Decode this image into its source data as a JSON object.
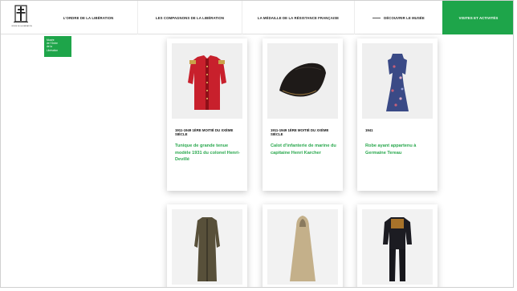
{
  "header": {
    "logo_text": "ORDRE DE LA LIBÉRATION",
    "nav": [
      {
        "label": "L'ORDRE DE LA LIBÉRATION"
      },
      {
        "label": "LES COMPAGNONS DE LA LIBÉRATION"
      },
      {
        "label": "LA MÉDAILLE DE LA RÉSISTANCE FRANÇAISE"
      },
      {
        "label": "DÉCOUVRIR LE MUSÉE"
      },
      {
        "label": "VISITES ET ACTIVITÉS"
      }
    ]
  },
  "badge": {
    "lines": [
      "Musée",
      "de l'Ordre",
      "de la",
      "Libération"
    ]
  },
  "cards": [
    {
      "date": "1911-1949 1ÈRE MOITIÉ DU XXÈME SIÈCLE",
      "title": "Tunique de grande tenue modèle 1931 du colonel Henri-Devillé",
      "image": "red-tunic"
    },
    {
      "date": "1911-1949 1ÈRE MOITIÉ DU XXÈME SIÈCLE",
      "title": "Calot d'infanterie de marine du capitaine Henri Karcher",
      "image": "calot-cap"
    },
    {
      "date": "1941",
      "title": "Robe ayant appartenu à Germaine Tereau",
      "image": "floral-dress"
    },
    {
      "date": "",
      "title": "",
      "image": "military-coat"
    },
    {
      "date": "",
      "title": "",
      "image": "hooded-cape"
    },
    {
      "date": "",
      "title": "",
      "image": "uniform"
    }
  ],
  "colors": {
    "accent": "#1ea54a",
    "title_green": "#2aa84e"
  }
}
